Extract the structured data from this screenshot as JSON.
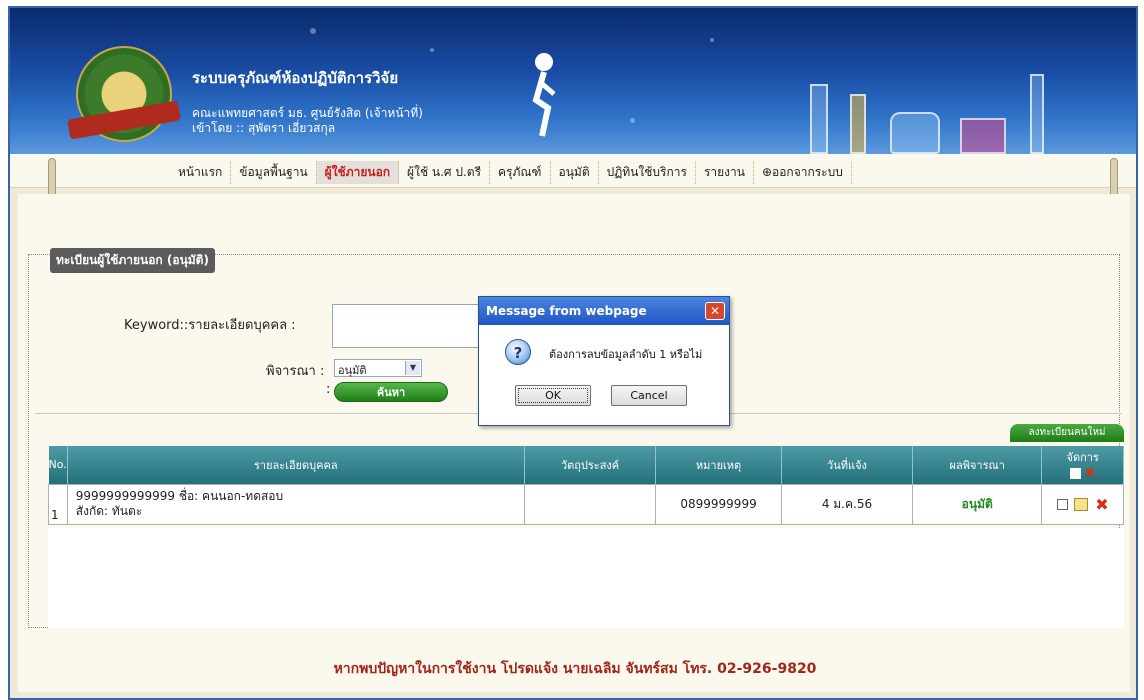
{
  "header": {
    "title": "ระบบครุภัณฑ์ห้องปฏิบัติการวิจัย",
    "subtitle": "คณะแพทยศาสตร์ มธ. ศูนย์รังสิต (เจ้าหน้าที่)",
    "login_line": "เข้าโดย :: สุพัตรา เอี่ยวสกุล",
    "logo_text": "คณะแพทยศาสตร์"
  },
  "nav": {
    "items": [
      {
        "label": "หน้าแรก",
        "active": false
      },
      {
        "label": "ข้อมูลพื้นฐาน",
        "active": false
      },
      {
        "label": "ผู้ใช้ภายนอก",
        "active": true
      },
      {
        "label": "ผู้ใช้ น.ศ ป.ตรี",
        "active": false
      },
      {
        "label": "ครุภัณฑ์",
        "active": false
      },
      {
        "label": "อนุมัติ",
        "active": false
      },
      {
        "label": "ปฏิทินใช้บริการ",
        "active": false
      },
      {
        "label": "รายงาน",
        "active": false
      },
      {
        "label": "ออกจากระบบ",
        "active": false
      }
    ]
  },
  "section": {
    "legend": "ทะเบียนผู้ใช้ภายนอก (อนุมัติ)"
  },
  "form": {
    "keyword_label": "Keyword::รายละเอียดบุคคล :",
    "keyword_value": "",
    "status_label": "พิจารณา :",
    "status_selected": "อนุมัติ",
    "extra_colon": ":",
    "search_button": "ค้นหา"
  },
  "register_button": "ลงทะเบียนคนใหม่",
  "table": {
    "headers": {
      "no": "No.",
      "details": "รายละเอียดบุคคล",
      "purpose": "วัตถุประสงค์",
      "note": "หมายเหตุ",
      "date": "วันที่แจ้ง",
      "result": "ผลพิจารณา",
      "manage": "จัดการ"
    },
    "rows": [
      {
        "no": "1",
        "details_line1": "9999999999999 ชื่อ: คนนอก-ทดสอบ",
        "details_line2": "สังกัด: ทันตะ",
        "purpose": "",
        "note": "0899999999",
        "date": "4 ม.ค.56",
        "result": "อนุมัติ"
      }
    ]
  },
  "footer": "หากพบปัญหาในการใช้งาน โปรดแจ้ง นายเฉลิม จันทร์สม โทร. 02-926-9820",
  "dialog": {
    "title": "Message from webpage",
    "message": "ต้องการลบข้อมูลลำดับ 1 หรือไม่",
    "ok": "OK",
    "cancel": "Cancel"
  },
  "colors": {
    "nav_active": "#c81e1e",
    "approved": "#1f8a1f",
    "footer": "#a0261a"
  },
  "icons": [
    "question-icon",
    "close-icon",
    "edit-icon",
    "delete-icon",
    "logout-icon"
  ]
}
